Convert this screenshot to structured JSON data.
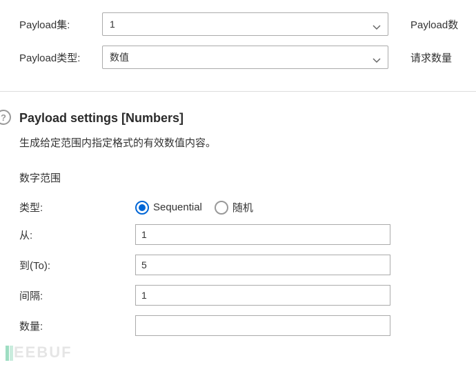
{
  "top": {
    "payload_set_label": "Payload集:",
    "payload_set_value": "1",
    "payload_type_label": "Payload类型:",
    "payload_type_value": "数值",
    "right1": "Payload数",
    "right2": "请求数量"
  },
  "section": {
    "badge": "?",
    "title": "Payload settings [Numbers]",
    "desc": "生成给定范围内指定格式的有效数值内容。",
    "sub": "数字范围",
    "type_label": "类型:",
    "radio_seq": "Sequential",
    "radio_rand": "随机",
    "from_label": "从:",
    "from_value": "1",
    "to_label": "到(To):",
    "to_value": "5",
    "step_label": "间隔:",
    "step_value": "1",
    "count_label": "数量:",
    "count_value": ""
  },
  "watermark": "EEBUF"
}
